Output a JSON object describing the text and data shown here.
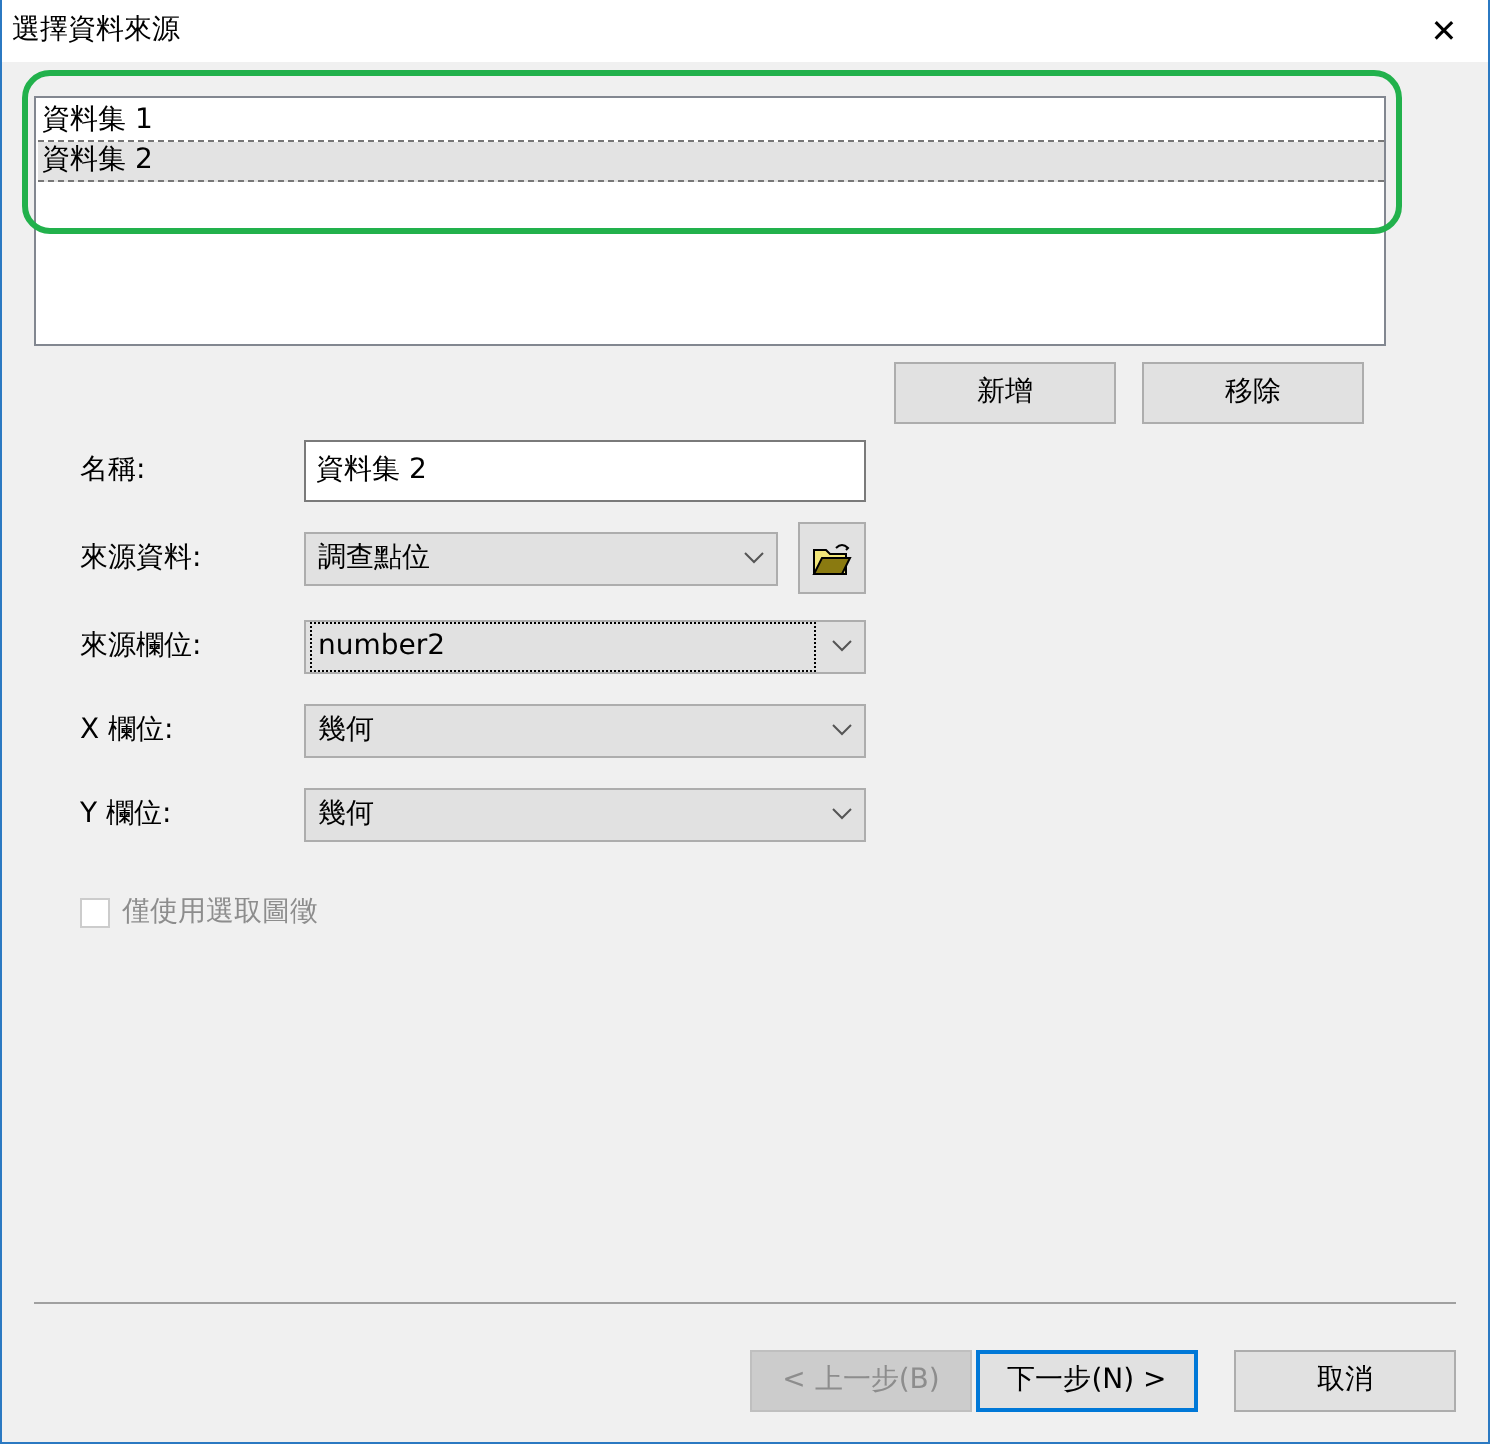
{
  "window": {
    "title": "選擇資料來源",
    "close": "✕"
  },
  "datasets": [
    {
      "label": "資料集 1",
      "selected": false
    },
    {
      "label": "資料集 2",
      "selected": true
    }
  ],
  "highlight": {
    "color": "#22b14c"
  },
  "list_buttons": [
    {
      "label": "新增"
    },
    {
      "label": "移除"
    }
  ],
  "fields": [
    {
      "kind": "text",
      "label": "名稱:",
      "value": "資料集 2"
    },
    {
      "kind": "combo_browse",
      "label": "來源資料:",
      "value": "調查點位",
      "focused": false
    },
    {
      "kind": "combo",
      "label": "來源欄位:",
      "value": "number2",
      "focused": true
    },
    {
      "kind": "combo",
      "label": "X 欄位:",
      "value": "幾何",
      "focused": false
    },
    {
      "kind": "combo",
      "label": "Y 欄位:",
      "value": "幾何",
      "focused": false
    }
  ],
  "checkbox": {
    "label": "僅使用選取圖徵",
    "checked": false,
    "disabled": true
  },
  "footer_buttons": [
    {
      "label": "< 上一步(B)",
      "disabled": true,
      "default": false
    },
    {
      "label": "下一步(N) >",
      "disabled": false,
      "default": true
    },
    {
      "label": "取消",
      "disabled": false,
      "default": false
    }
  ]
}
